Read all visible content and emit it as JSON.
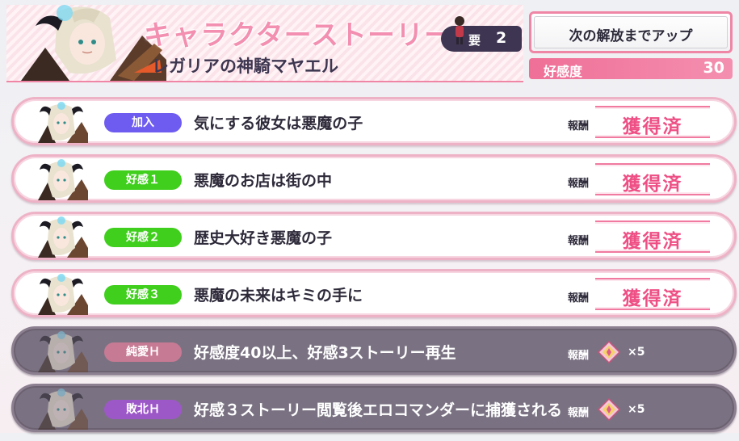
{
  "header": {
    "title": "キャラクターストーリー",
    "character_name": "レガリアの神騎マヤエル",
    "requirement": {
      "label": "要",
      "value": "2"
    },
    "unlock_button_label": "次の解放までアップ",
    "affection": {
      "label": "好感度",
      "value": "30"
    }
  },
  "colors": {
    "accent_pink": "#ef86a6",
    "pill_join": "#6e5cf0",
    "pill_affection": "#3fcf1c",
    "pill_pure_love": "#c77a93",
    "pill_defeat": "#9d58c8",
    "locked_row": "#7a7282"
  },
  "stories": [
    {
      "tag": "加入",
      "tag_color": "#6e5cf0",
      "title": "気にする彼女は悪魔の子",
      "reward_label": "報酬",
      "status": "獲得済",
      "locked": false
    },
    {
      "tag": "好感１",
      "tag_color": "#3fcf1c",
      "title": "悪魔のお店は街の中",
      "reward_label": "報酬",
      "status": "獲得済",
      "locked": false
    },
    {
      "tag": "好感２",
      "tag_color": "#3fcf1c",
      "title": "歴史大好き悪魔の子",
      "reward_label": "報酬",
      "status": "獲得済",
      "locked": false
    },
    {
      "tag": "好感３",
      "tag_color": "#3fcf1c",
      "title": "悪魔の未来はキミの手に",
      "reward_label": "報酬",
      "status": "獲得済",
      "locked": false
    },
    {
      "tag": "純愛Ｈ",
      "tag_color": "#c77a93",
      "title": "好感度40以上、好感3ストーリー再生",
      "reward_label": "報酬",
      "reward_qty": "×5",
      "reward_icon": "crystal-icon",
      "locked": true
    },
    {
      "tag": "敗北Ｈ",
      "tag_color": "#9d58c8",
      "title": "好感３ストーリー閲覧後エロコマンダーに捕獲される",
      "reward_label": "報酬",
      "reward_qty": "×5",
      "reward_icon": "crystal-icon",
      "locked": true
    }
  ]
}
